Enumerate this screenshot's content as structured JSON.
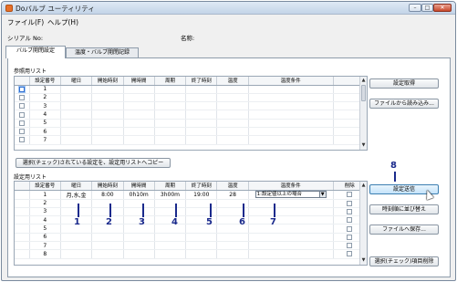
{
  "window": {
    "title": "Doバルブ ユーティリティ",
    "min_glyph": "–",
    "max_glyph": "□",
    "close_glyph": "✕"
  },
  "menu": {
    "file": "ファイル(F)",
    "help": "ヘルプ(H)"
  },
  "info": {
    "serial_label": "シリアル No:",
    "serial_value": "",
    "name_label": "名称:",
    "name_value": ""
  },
  "tabs": [
    {
      "label": "バルブ開閉設定"
    },
    {
      "label": "温度・バルブ開閉記録"
    }
  ],
  "reference_list": {
    "label": "参照用リスト",
    "columns": [
      "設定番号",
      "曜日",
      "開始時刻",
      "開時間",
      "周期",
      "終了時刻",
      "温度",
      "温度条件"
    ],
    "rows": [
      {
        "no": "1"
      },
      {
        "no": "2"
      },
      {
        "no": "3"
      },
      {
        "no": "4"
      },
      {
        "no": "5"
      },
      {
        "no": "6"
      },
      {
        "no": "7"
      }
    ],
    "buttons": {
      "get_settings": "設定取得",
      "load_file": "ファイルから読み込み..."
    },
    "copy_button": "選択(チェック)されている設定を、設定用リストへコピー"
  },
  "setting_list": {
    "label": "設定用リスト",
    "columns": [
      "設定番号",
      "曜日",
      "開始時刻",
      "開時間",
      "周期",
      "終了時刻",
      "温度",
      "温度条件",
      "削除"
    ],
    "rows": [
      {
        "no": "1",
        "weekday": "月,水,金",
        "start": "8:00",
        "open": "0h10m",
        "cycle": "3h00m",
        "end": "19:00",
        "temp": "28",
        "condition": "1:設定値以上の場合"
      },
      {
        "no": "2"
      },
      {
        "no": "3"
      },
      {
        "no": "4"
      },
      {
        "no": "5"
      },
      {
        "no": "6"
      },
      {
        "no": "7"
      },
      {
        "no": "8"
      }
    ],
    "buttons": {
      "send_settings": "設定送信",
      "sort_by_time": "時刻順に並び替え",
      "save_file": "ファイルへ保存...",
      "delete_checked": "選択(チェック)項目削除"
    }
  },
  "callouts": [
    "1",
    "2",
    "3",
    "4",
    "5",
    "6",
    "7",
    "8"
  ],
  "colors": {
    "callout": "#1a2a8c",
    "title_bar": "#c3d4e8",
    "close_button": "#c8482b"
  }
}
